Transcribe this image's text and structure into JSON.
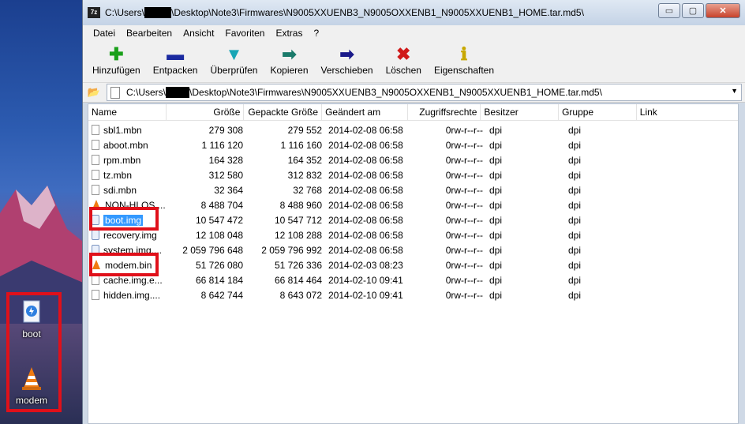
{
  "window": {
    "title_prefix": "C:\\Users\\",
    "title_suffix": "\\Desktop\\Note3\\Firmwares\\N9005XXUENB3_N9005OXXENB1_N9005XXUENB1_HOME.tar.md5\\",
    "app_icon": "7z",
    "buttons": {
      "minimize": "▭",
      "maximize": "▢",
      "close": "✕"
    }
  },
  "menu": [
    "Datei",
    "Bearbeiten",
    "Ansicht",
    "Favoriten",
    "Extras",
    "?"
  ],
  "toolbar": [
    {
      "label": "Hinzufügen",
      "icon": "plus-icon",
      "glyph": "✚",
      "color": "#1aa01a"
    },
    {
      "label": "Entpacken",
      "icon": "minus-icon",
      "glyph": "▬",
      "color": "#1a2aa0"
    },
    {
      "label": "Überprüfen",
      "icon": "check-icon",
      "glyph": "⌵",
      "color": "#17a5b5"
    },
    {
      "label": "Kopieren",
      "icon": "copy-arrow-icon",
      "glyph": "➡",
      "color": "#1a7a6a"
    },
    {
      "label": "Verschieben",
      "icon": "move-arrow-icon",
      "glyph": "➡",
      "color": "#1a1a8a"
    },
    {
      "label": "Löschen",
      "icon": "delete-x-icon",
      "glyph": "✖",
      "color": "#d01a1a"
    },
    {
      "label": "Eigenschaften",
      "icon": "info-icon",
      "glyph": "ℹ",
      "color": "#c8a800"
    }
  ],
  "address": {
    "prefix": "C:\\Users\\",
    "suffix": "\\Desktop\\Note3\\Firmwares\\N9005XXUENB3_N9005OXXENB1_N9005XXUENB1_HOME.tar.md5\\"
  },
  "columns": [
    "Name",
    "Größe",
    "Gepackte Größe",
    "Geändert am",
    "Zugriffsrechte",
    "Besitzer",
    "Gruppe",
    "Link"
  ],
  "files": [
    {
      "name": "sbl1.mbn",
      "size": "279 308",
      "packed": "279 552",
      "modified": "2014-02-08 06:58",
      "attr": "0rw-r--r--",
      "owner": "dpi",
      "group": "dpi",
      "icon": "file"
    },
    {
      "name": "aboot.mbn",
      "size": "1 116 120",
      "packed": "1 116 160",
      "modified": "2014-02-08 06:58",
      "attr": "0rw-r--r--",
      "owner": "dpi",
      "group": "dpi",
      "icon": "file"
    },
    {
      "name": "rpm.mbn",
      "size": "164 328",
      "packed": "164 352",
      "modified": "2014-02-08 06:58",
      "attr": "0rw-r--r--",
      "owner": "dpi",
      "group": "dpi",
      "icon": "file"
    },
    {
      "name": "tz.mbn",
      "size": "312 580",
      "packed": "312 832",
      "modified": "2014-02-08 06:58",
      "attr": "0rw-r--r--",
      "owner": "dpi",
      "group": "dpi",
      "icon": "file"
    },
    {
      "name": "sdi.mbn",
      "size": "32 364",
      "packed": "32 768",
      "modified": "2014-02-08 06:58",
      "attr": "0rw-r--r--",
      "owner": "dpi",
      "group": "dpi",
      "icon": "file"
    },
    {
      "name": "NON-HLOS....",
      "size": "8 488 704",
      "packed": "8 488 960",
      "modified": "2014-02-08 06:58",
      "attr": "0rw-r--r--",
      "owner": "dpi",
      "group": "dpi",
      "icon": "vlc"
    },
    {
      "name": "boot.img",
      "size": "10 547 472",
      "packed": "10 547 712",
      "modified": "2014-02-08 06:58",
      "attr": "0rw-r--r--",
      "owner": "dpi",
      "group": "dpi",
      "icon": "img",
      "selected": true
    },
    {
      "name": "recovery.img",
      "size": "12 108 048",
      "packed": "12 108 288",
      "modified": "2014-02-08 06:58",
      "attr": "0rw-r--r--",
      "owner": "dpi",
      "group": "dpi",
      "icon": "img"
    },
    {
      "name": "system.img....",
      "size": "2 059 796 648",
      "packed": "2 059 796 992",
      "modified": "2014-02-08 06:58",
      "attr": "0rw-r--r--",
      "owner": "dpi",
      "group": "dpi",
      "icon": "img"
    },
    {
      "name": "modem.bin",
      "size": "51 726 080",
      "packed": "51 726 336",
      "modified": "2014-02-03 08:23",
      "attr": "0rw-r--r--",
      "owner": "dpi",
      "group": "dpi",
      "icon": "vlc"
    },
    {
      "name": "cache.img.e...",
      "size": "66 814 184",
      "packed": "66 814 464",
      "modified": "2014-02-10 09:41",
      "attr": "0rw-r--r--",
      "owner": "dpi",
      "group": "dpi",
      "icon": "file"
    },
    {
      "name": "hidden.img....",
      "size": "8 642 744",
      "packed": "8 643 072",
      "modified": "2014-02-10 09:41",
      "attr": "0rw-r--r--",
      "owner": "dpi",
      "group": "dpi",
      "icon": "file"
    }
  ],
  "desktop": {
    "icons": [
      {
        "label": "boot",
        "icon": "image-file-icon"
      },
      {
        "label": "modem",
        "icon": "vlc-cone-icon"
      }
    ]
  },
  "colors": {
    "highlight": "#e0101a",
    "selection": "#3399ff"
  }
}
